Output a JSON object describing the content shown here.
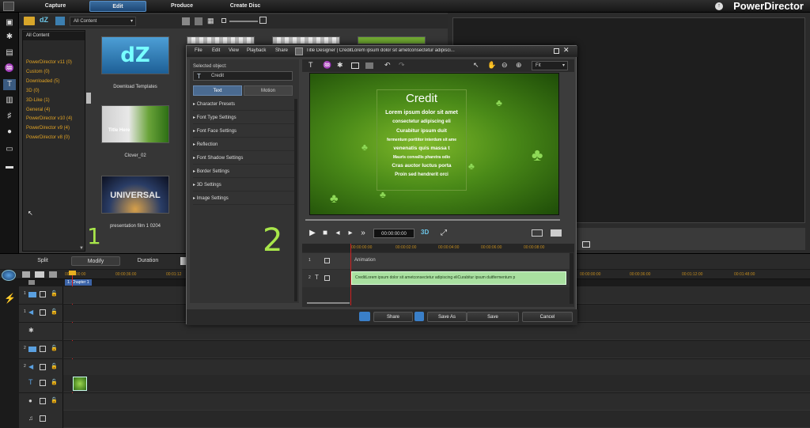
{
  "app": {
    "brand": "PowerDirector"
  },
  "mode_tabs": [
    {
      "label": "Capture",
      "active": false
    },
    {
      "label": "Edit",
      "active": true
    },
    {
      "label": "Produce",
      "active": false
    },
    {
      "label": "Create Disc",
      "active": false
    }
  ],
  "library": {
    "filter": "All Content",
    "tree_header": "All Content",
    "tree_items": [
      "PowerDirector v11  (0)",
      "Custom  (0)",
      "Downloaded  (5)",
      "3D  (0)",
      "3D-Like  (1)",
      "General  (4)",
      "PowerDirector v10  (4)",
      "PowerDirector v9  (4)",
      "PowerDirector v8  (0)"
    ],
    "thumbs": [
      {
        "label": "Download Templates",
        "art": "dZ"
      },
      {
        "label": "Clover_02",
        "art": "Title Here"
      },
      {
        "label": "presentation film 1 0204",
        "art": "UNIVERSAL"
      }
    ],
    "annotation": "1"
  },
  "timeline": {
    "buttons": {
      "split": "Split",
      "modify": "Modify",
      "duration": "Duration"
    },
    "chapter": "1. Chapter 1",
    "ticks": [
      "00:00:00:00",
      "00:00:36:00",
      "00:01:12",
      "00:00:00:00",
      "00:00:36:00",
      "00:01:12:00",
      "00:01:48:00"
    ],
    "track_numbers": [
      "1",
      "1",
      "2",
      "2"
    ]
  },
  "dialog": {
    "title": "Title Designer  |  CreditLorem ipsum dolor sit ametconsectetur adipisci...",
    "menu": [
      "File",
      "Edit",
      "View",
      "Playback",
      "Share"
    ],
    "selected_label": "Selected object:",
    "selected_value": "Credit",
    "tabs": {
      "text": "Text",
      "motion": "Motion"
    },
    "sections": [
      "Character Presets",
      "Font Type Settings",
      "Font Face Settings",
      "Reflection",
      "Font Shadow Settings",
      "Border Settings",
      "3D Settings",
      "Image Settings"
    ],
    "annotation": "2",
    "zoom": "Fit",
    "canvas": {
      "heading": "Credit",
      "lines": [
        "Lorem ipsum dolor sit amet",
        "consectetur adipiscing eli",
        "Curabitur ipsum duit",
        "fermentum porttitor interdum sit ame",
        "venenatis quis massa t",
        "Mauris convallis pharetra odio",
        "Cras auctor luctus porta",
        "Proin sed hendrerit orci"
      ]
    },
    "timecode": "00:00:00:00",
    "mode_3d": "3D",
    "dtl_ticks": [
      "00:00:00:00",
      "00:00:02:00",
      "00:00:04:00",
      "00:00:06:00",
      "00:00:08:00"
    ],
    "dtl_rows": {
      "row1_num": "1",
      "row2_num": "2",
      "animation": "Animation",
      "clip": "CreditLorem ipsum dolor sit ametconsectetur adipiscing eliCurabitur ipsum duitfermentum p"
    },
    "footer": {
      "share": "Share",
      "save_as": "Save As",
      "save": "Save",
      "cancel": "Cancel"
    }
  }
}
